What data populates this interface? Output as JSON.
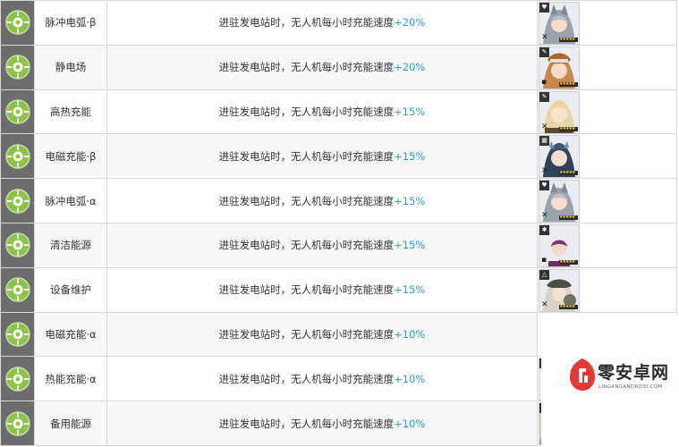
{
  "rows": [
    {
      "name": "脉冲电弧·β",
      "desc": "进驻发电站时，无人机每小时充能速度",
      "bonus": "+20%",
      "job": "♥"
    },
    {
      "name": "静电场",
      "desc": "进驻发电站时，无人机每小时充能速度",
      "bonus": "+20%",
      "job": "✎"
    },
    {
      "name": "高热充能",
      "desc": "进驻发电站时，无人机每小时充能速度",
      "bonus": "+15%",
      "job": "✎"
    },
    {
      "name": "电磁充能·β",
      "desc": "进驻发电站时，无人机每小时充能速度",
      "bonus": "+15%",
      "job": "▦"
    },
    {
      "name": "脉冲电弧·α",
      "desc": "进驻发电站时，无人机每小时充能速度",
      "bonus": "+15%",
      "job": "♥"
    },
    {
      "name": "清洁能源",
      "desc": "进驻发电站时，无人机每小时充能速度",
      "bonus": "+15%",
      "job": "✱"
    },
    {
      "name": "设备维护",
      "desc": "进驻发电站时，无人机每小时充能速度",
      "bonus": "+15%",
      "job": "△"
    },
    {
      "name": "电磁充能·α",
      "desc": "进驻发电站时，无人机每小时充能速度",
      "bonus": "+10%",
      "job": ""
    },
    {
      "name": "热能充能·α",
      "desc": "进驻发电站时，无人机每小时充能速度",
      "bonus": "+10%",
      "job": "✎"
    },
    {
      "name": "备用能源",
      "desc": "进驻发电站时，无人机每小时充能速度",
      "bonus": "+10%",
      "job": ""
    }
  ],
  "stars": "★★★★★",
  "watermark": {
    "name": "零安卓网",
    "url": "LINGANGANDROID.COM"
  }
}
